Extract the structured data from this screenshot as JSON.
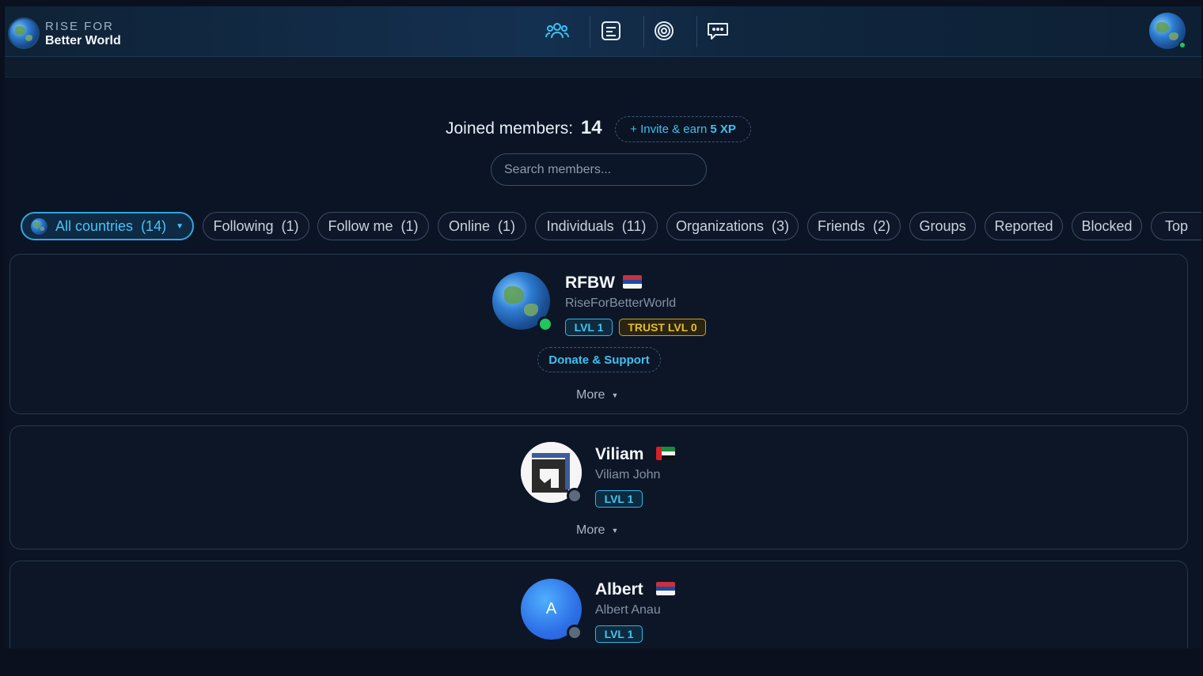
{
  "brand": {
    "line1": "RISE FOR",
    "line2": "Better World"
  },
  "nav": [
    {
      "name": "members-icon",
      "color": "#3fc1f0"
    },
    {
      "name": "list-icon",
      "color": "#e6edf5"
    },
    {
      "name": "target-icon",
      "color": "#e6edf5"
    },
    {
      "name": "chat-icon",
      "color": "#e6edf5"
    }
  ],
  "members_header": {
    "joined_label": "Joined members:",
    "joined_count": "14",
    "invite_label": "+ Invite & earn",
    "invite_xp": "5 XP",
    "search_placeholder": "Search members..."
  },
  "filters": [
    {
      "label": "All countries",
      "count": "(14)",
      "active": true
    },
    {
      "label": "Following",
      "count": "(1)"
    },
    {
      "label": "Follow me",
      "count": "(1)"
    },
    {
      "label": "Online",
      "count": "(1)"
    },
    {
      "label": "Individuals",
      "count": "(11)"
    },
    {
      "label": "Organizations",
      "count": "(3)"
    },
    {
      "label": "Friends",
      "count": "(2)"
    },
    {
      "label": "Groups"
    },
    {
      "label": "Reported"
    },
    {
      "label": "Blocked"
    },
    {
      "label": "Top"
    }
  ],
  "members": [
    {
      "name": "RFBW",
      "handle": "RiseForBetterWorld",
      "flag": "serbia",
      "level": "LVL 1",
      "trust": "TRUST LVL 0",
      "online": true,
      "donate": "Donate & Support",
      "more": "More"
    },
    {
      "name": "Viliam",
      "handle": "Viliam John",
      "flag": "uae",
      "level": "LVL 1",
      "online": false,
      "more": "More"
    },
    {
      "name": "Albert",
      "handle": "Albert Anau",
      "flag": "serbia",
      "level": "LVL 1",
      "online": false,
      "avatar_letter": "A"
    }
  ],
  "colors": {
    "accent": "#3fc1f0",
    "online": "#22c55e",
    "offline": "#5b6b7d",
    "trust": "#e5bd2c"
  }
}
